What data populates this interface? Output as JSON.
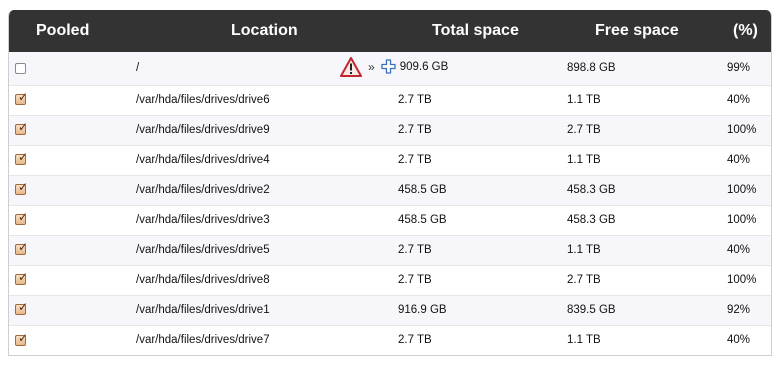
{
  "table": {
    "headers": {
      "pooled": "Pooled",
      "location": "Location",
      "total": "Total space",
      "free": "Free space",
      "pct": "(%)"
    },
    "rows": [
      {
        "pooled": false,
        "location": "/",
        "total": "909.6 GB",
        "free": "898.8 GB",
        "pct": "99%",
        "icons": [
          "warning-icon",
          "raquo",
          "add-icon"
        ],
        "separator": "»"
      },
      {
        "pooled": true,
        "location": "/var/hda/files/drives/drive6",
        "total": "2.7 TB",
        "free": "1.1 TB",
        "pct": "40%"
      },
      {
        "pooled": true,
        "location": "/var/hda/files/drives/drive9",
        "total": "2.7 TB",
        "free": "2.7 TB",
        "pct": "100%"
      },
      {
        "pooled": true,
        "location": "/var/hda/files/drives/drive4",
        "total": "2.7 TB",
        "free": "1.1 TB",
        "pct": "40%"
      },
      {
        "pooled": true,
        "location": "/var/hda/files/drives/drive2",
        "total": "458.5 GB",
        "free": "458.3 GB",
        "pct": "100%"
      },
      {
        "pooled": true,
        "location": "/var/hda/files/drives/drive3",
        "total": "458.5 GB",
        "free": "458.3 GB",
        "pct": "100%"
      },
      {
        "pooled": true,
        "location": "/var/hda/files/drives/drive5",
        "total": "2.7 TB",
        "free": "1.1 TB",
        "pct": "40%"
      },
      {
        "pooled": true,
        "location": "/var/hda/files/drives/drive8",
        "total": "2.7 TB",
        "free": "2.7 TB",
        "pct": "100%"
      },
      {
        "pooled": true,
        "location": "/var/hda/files/drives/drive1",
        "total": "916.9 GB",
        "free": "839.5 GB",
        "pct": "92%"
      },
      {
        "pooled": true,
        "location": "/var/hda/files/drives/drive7",
        "total": "2.7 TB",
        "free": "1.1 TB",
        "pct": "40%"
      }
    ]
  },
  "colors": {
    "header_bg": "#333333",
    "header_text": "#ffffff",
    "checkbox_checked": "#e7b98b",
    "warning_red": "#c0262c",
    "add_blue": "#3b6fb6"
  }
}
